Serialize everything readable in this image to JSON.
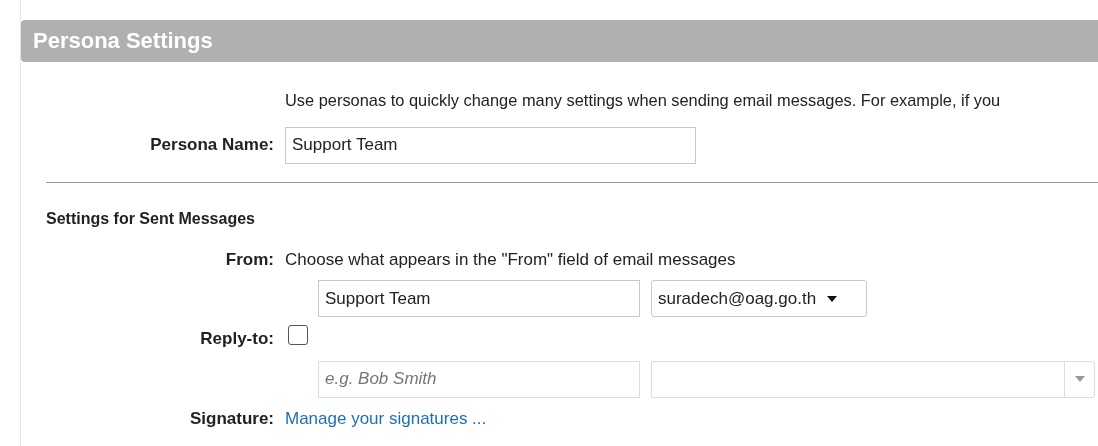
{
  "panel": {
    "title": "Persona Settings"
  },
  "description": "Use personas to quickly change many settings when sending email messages. For example, if you",
  "persona_name": {
    "label": "Persona Name:",
    "value": "Support Team"
  },
  "section": {
    "title": "Settings for Sent Messages"
  },
  "from": {
    "label": "From:",
    "text": "Choose what appears in the \"From\" field of email messages",
    "name_value": "Support Team",
    "address_value": "suradech@oag.go.th"
  },
  "reply_to": {
    "label": "Reply-to:",
    "checked": false,
    "name_placeholder": "e.g. Bob Smith"
  },
  "signature": {
    "label": "Signature:",
    "link": "Manage your signatures ..."
  }
}
